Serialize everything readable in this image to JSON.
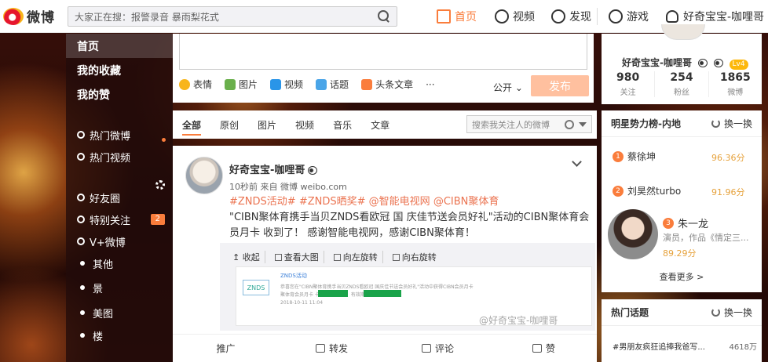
{
  "brand": {
    "logo_text": "微博"
  },
  "search": {
    "placeholder": "大家正在搜：报警录音 暴雨梨花式"
  },
  "topnav": [
    {
      "label": "首页",
      "icon": "home-icon",
      "active": true
    },
    {
      "label": "视频",
      "icon": "video-icon"
    },
    {
      "label": "发现",
      "icon": "compass-icon"
    },
    {
      "label": "游戏",
      "icon": "gamepad-icon"
    },
    {
      "label": "好奇宝宝-咖哩哥",
      "icon": "user-icon"
    }
  ],
  "sidebar": {
    "main": [
      "首页",
      "我的收藏",
      "我的赞"
    ],
    "items": [
      {
        "label": "热门微博",
        "icon": "fire-icon"
      },
      {
        "label": "热门视频",
        "icon": "play-icon"
      },
      {
        "label": "好友圈",
        "icon": "heart-icon"
      },
      {
        "label": "特别关注",
        "icon": "star-icon",
        "badge": "2"
      },
      {
        "label": "V+微博",
        "icon": "vplus-icon"
      },
      {
        "label": "其他"
      },
      {
        "label": "景"
      },
      {
        "label": "美图"
      },
      {
        "label": "楼"
      }
    ]
  },
  "compose": {
    "tools": [
      "表情",
      "图片",
      "视频",
      "话题",
      "头条文章",
      "···"
    ],
    "visibility": "公开",
    "publish": "发布"
  },
  "tabs": {
    "items": [
      "全部",
      "原创",
      "图片",
      "视频",
      "音乐",
      "文章"
    ],
    "search_placeholder": "搜索我关注人的微博"
  },
  "post": {
    "author": "好奇宝宝-咖哩哥",
    "meta": "10秒前 来自 微博 weibo.com",
    "tags": [
      "#ZNDS活动#",
      "#ZNDS晒奖#",
      "@智能电视网",
      "@CIBN聚体育"
    ],
    "text": "\"CIBN聚体育携手当贝ZNDS看欧冠 国 庆佳节送会员好礼\"活动的CIBN聚体育会员月卡 收到了！ 感谢智能电视网，感谢CIBN聚体育！",
    "media_ops": [
      "收起",
      "查看大图",
      "向左旋转",
      "向右旋转"
    ],
    "thumb": {
      "logo": "ZNDS",
      "title": "ZNDS活动",
      "line1": "恭喜您在\"CIBN聚体育携手当贝ZNDS看欧冠 国庆佳节送会员好礼\"活动中获得CIBN会员月卡",
      "line2": "聚体育会员月卡 卡号：            密码：            ，有效期至11月1日",
      "date": "2018-10-11 11:04"
    },
    "watermark": "@好奇宝宝-咖哩哥",
    "actions": [
      "推广",
      "转发",
      "评论",
      "赞"
    ]
  },
  "profile": {
    "name": "好奇宝宝-咖哩哥",
    "level": "Lv4",
    "stats": [
      {
        "num": "980",
        "label": "关注"
      },
      {
        "num": "254",
        "label": "粉丝"
      },
      {
        "num": "1865",
        "label": "微博"
      }
    ]
  },
  "ranking": {
    "title": "明星势力榜-内地",
    "refresh": "换一换",
    "items": [
      {
        "rank": "1",
        "name": "蔡徐坤",
        "score": "96.36分"
      },
      {
        "rank": "2",
        "name": "刘昊然turbo",
        "score": "91.96分"
      }
    ],
    "featured": {
      "rank": "3",
      "name": "朱一龙",
      "desc": "演员，作品《情定三...",
      "score": "89.29分"
    },
    "more": "查看更多 >"
  },
  "hot_topics": {
    "title": "热门话题",
    "refresh": "换一换",
    "items": [
      {
        "topic": "#男朋友疯狂追捧我爸写...",
        "count": "4618万"
      }
    ]
  }
}
